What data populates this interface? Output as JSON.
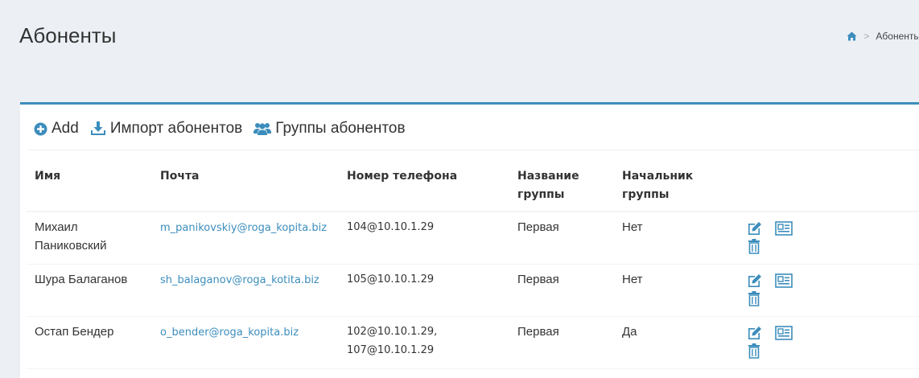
{
  "page": {
    "title": "Абоненты"
  },
  "breadcrumb": {
    "home_icon": "home-icon",
    "separator": ">",
    "current": "Абоненты"
  },
  "toolbar": {
    "add_label": "Add",
    "add_icon": "plus-circle-icon",
    "import_label": "Импорт абонентов",
    "import_icon": "download-icon",
    "groups_label": "Группы абонентов",
    "groups_icon": "users-icon"
  },
  "table": {
    "columns": {
      "name": "Имя",
      "email": "Почта",
      "phone": "Номер телефона",
      "group_line1": "Название",
      "group_line2": "группы",
      "head_line1": "Начальник",
      "head_line2": "группы"
    },
    "rows": [
      {
        "name_line1": "Михаил",
        "name_line2": "Паниковский",
        "email": "m_panikovskiy@roga_kopita.biz",
        "phone_line1": "104@10.10.1.29",
        "phone_line2": "",
        "group": "Первая",
        "head": "Нет"
      },
      {
        "name_line1": "Шура Балаганов",
        "name_line2": "",
        "email": "sh_balaganov@roga_kotita.biz",
        "phone_line1": "105@10.10.1.29",
        "phone_line2": "",
        "group": "Первая",
        "head": "Нет"
      },
      {
        "name_line1": "Остап Бендер",
        "name_line2": "",
        "email": "o_bender@roga_kopita.biz",
        "phone_line1": "102@10.10.1.29,",
        "phone_line2": "107@10.10.1.29",
        "group": "Первая",
        "head": "Да"
      }
    ],
    "row_actions": {
      "edit_icon": "edit-icon",
      "card_icon": "contact-card-icon",
      "delete_icon": "trash-icon"
    }
  },
  "colors": {
    "accent": "#3c8dbc",
    "background": "#ecf0f5",
    "panel": "#ffffff",
    "text": "#333333"
  }
}
